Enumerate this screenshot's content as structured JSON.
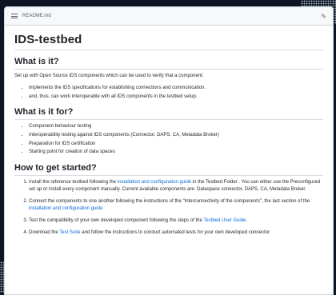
{
  "file": {
    "name": "README.md",
    "list_icon": "list-icon",
    "edit_icon": "pencil-icon"
  },
  "title": "IDS-testbed",
  "sections": {
    "what": {
      "heading": "What is it?",
      "intro": "Set up with Open Source IDS components which can be used to verify that a component:",
      "bullets": [
        "implements the IDS specifications for establishing connections and communication.",
        "and, thus, can work interoperable with all IDS components in the testbed setup."
      ]
    },
    "for": {
      "heading": "What is it for?",
      "bullets": [
        "Component behaviour testing",
        "Interoperability testing against IDS components (Connector, DAPS, CA, Metadata Broker)",
        "Preparation for IDS certification",
        "Starting point for creation of data spaces"
      ]
    },
    "start": {
      "heading": "How to get started?",
      "step1": {
        "a": "Install the reference testbed following the ",
        "link": "installation and configuration guide",
        "b": " in the Testbed Folder . You can either use the Preconfigured set up or install every component manually. Current available components are: Dataspace connector, DAPS, CA, Metadata Broker."
      },
      "step2": {
        "a": "Connect the components to one another following the instructions of the \"Interconnectivity of the components\", the last section of the ",
        "link": "installation and configuration guide"
      },
      "step3": {
        "a": "Test the compatibility of your own developed component following the steps of the ",
        "link": "Testbed User Guide",
        "b": "."
      },
      "step4": {
        "a": "Download the ",
        "link": "Test Suite",
        "b": " and follow the instructions to conduct automated tests for your own developed connector"
      }
    }
  },
  "colors": {
    "link": "#0969da",
    "text": "#1f2328",
    "background": "#0f1623"
  }
}
